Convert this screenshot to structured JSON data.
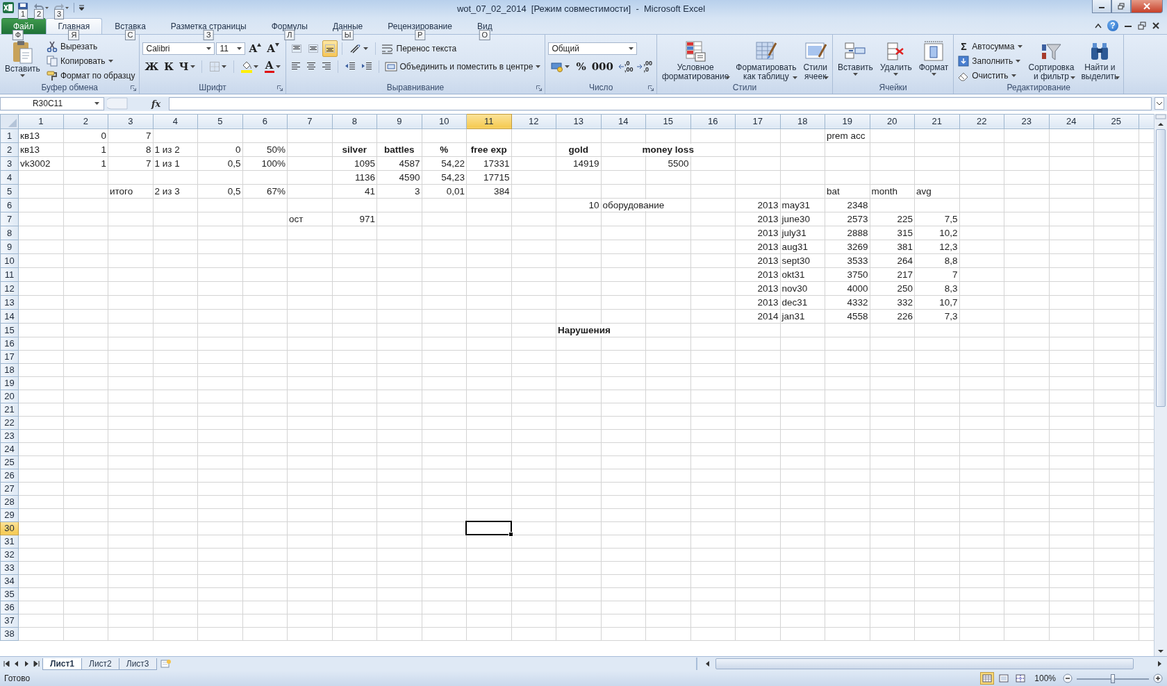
{
  "window": {
    "title": "wot_07_02_2014  [Режим совместимости]  -  Microsoft Excel",
    "help": "?"
  },
  "quick_access": {
    "keytips": [
      "1",
      "2",
      "3"
    ]
  },
  "ribbon_tabs": [
    {
      "label": "Файл",
      "keytip": "Ф",
      "kind": "file",
      "selected": false
    },
    {
      "label": "Главная",
      "keytip": "Я",
      "kind": "tab",
      "selected": true
    },
    {
      "label": "Вставка",
      "keytip": "С",
      "kind": "tab",
      "selected": false
    },
    {
      "label": "Разметка страницы",
      "keytip": "З",
      "kind": "tab",
      "selected": false
    },
    {
      "label": "Формулы",
      "keytip": "Л",
      "kind": "tab",
      "selected": false
    },
    {
      "label": "Данные",
      "keytip": "Ы",
      "kind": "tab",
      "selected": false
    },
    {
      "label": "Рецензирование",
      "keytip": "Р",
      "kind": "tab",
      "selected": false
    },
    {
      "label": "Вид",
      "keytip": "О",
      "kind": "tab",
      "selected": false
    }
  ],
  "ribbon_groups": [
    {
      "label": "Буфер обмена",
      "launcher": true,
      "controls": [
        {
          "kind": "large",
          "label_lines": [
            "Вставить"
          ],
          "dropdown": true
        },
        {
          "kind": "stack",
          "items": [
            {
              "kind": "text",
              "label": "Вырезать"
            },
            {
              "kind": "text",
              "label": "Копировать",
              "dropdown": true
            },
            {
              "kind": "text",
              "label": "Формат по образцу"
            }
          ]
        }
      ]
    },
    {
      "label": "Шрифт",
      "launcher": true,
      "controls": [
        {
          "kind": "rows",
          "rows": [
            [
              {
                "kind": "combo",
                "value": "Calibri"
              },
              {
                "kind": "combo",
                "value": "11"
              },
              {
                "kind": "glyph",
                "text": "A"
              },
              {
                "kind": "glyph",
                "text": "A"
              }
            ],
            [
              {
                "kind": "glyph",
                "text": "Ж"
              },
              {
                "kind": "glyph",
                "text": "К"
              },
              {
                "kind": "glyph",
                "text": "Ч",
                "dropdown": true
              },
              {
                "kind": "sep"
              },
              {
                "kind": "icon",
                "dropdown": true
              },
              {
                "kind": "sep"
              },
              {
                "kind": "icon",
                "dropdown": true
              },
              {
                "kind": "glyph",
                "text": "A",
                "dropdown": true
              }
            ]
          ]
        }
      ]
    },
    {
      "label": "Выравнивание",
      "launcher": true,
      "controls": [
        {
          "kind": "rows",
          "rows": [
            [
              {
                "kind": "icon",
                "on": false
              },
              {
                "kind": "icon",
                "on": false
              },
              {
                "kind": "icon",
                "on": true
              },
              {
                "kind": "sep"
              },
              {
                "kind": "icon",
                "dropdown": true
              },
              {
                "kind": "sep"
              },
              {
                "kind": "text",
                "label": "Перенос текста"
              }
            ],
            [
              {
                "kind": "icon",
                "on": false
              },
              {
                "kind": "icon",
                "on": false
              },
              {
                "kind": "icon",
                "on": false
              },
              {
                "kind": "sep"
              },
              {
                "kind": "icon"
              },
              {
                "kind": "icon"
              },
              {
                "kind": "sep"
              },
              {
                "kind": "text",
                "label": "Объединить и поместить в центре",
                "dropdown": true
              }
            ]
          ]
        }
      ]
    },
    {
      "label": "Число",
      "launcher": true,
      "controls": [
        {
          "kind": "rows",
          "rows": [
            [
              {
                "kind": "combo",
                "value": "Общий"
              }
            ],
            [
              {
                "kind": "icon",
                "dropdown": true
              },
              {
                "kind": "glyph",
                "text": "%"
              },
              {
                "kind": "glyph",
                "text": "000"
              },
              {
                "kind": "decimal",
                "lines": [
                  ",0",
                  ",00"
                ]
              },
              {
                "kind": "decimal",
                "lines": [
                  ",00",
                  ",0"
                ]
              }
            ]
          ]
        }
      ]
    },
    {
      "label": "Стили",
      "controls": [
        {
          "kind": "large",
          "label_lines": [
            "Условное",
            "форматирование"
          ],
          "dropdown": true
        },
        {
          "kind": "large",
          "label_lines": [
            "Форматировать",
            "как таблицу"
          ],
          "dropdown": true
        },
        {
          "kind": "large",
          "label_lines": [
            "Стили",
            "ячеек"
          ],
          "dropdown": true
        }
      ]
    },
    {
      "label": "Ячейки",
      "controls": [
        {
          "kind": "large",
          "label_lines": [
            "Вставить"
          ],
          "dropdown": true
        },
        {
          "kind": "large",
          "label_lines": [
            "Удалить"
          ],
          "dropdown": true
        },
        {
          "kind": "large",
          "label_lines": [
            "Формат"
          ],
          "dropdown": true
        }
      ]
    },
    {
      "label": "Редактирование",
      "controls": [
        {
          "kind": "stack",
          "items": [
            {
              "kind": "text",
              "glyph": "Σ",
              "label": "Автосумма",
              "dropdown": true
            },
            {
              "kind": "text",
              "label": "Заполнить",
              "dropdown": true
            },
            {
              "kind": "text",
              "label": "Очистить",
              "dropdown": true
            }
          ]
        },
        {
          "kind": "large",
          "label_lines": [
            "Сортировка",
            "и фильтр"
          ],
          "dropdown": true
        },
        {
          "kind": "large",
          "label_lines": [
            "Найти и",
            "выделить"
          ],
          "dropdown": true
        }
      ]
    }
  ],
  "formula_bar": {
    "name_box": "R30C11",
    "fx": "fx"
  },
  "columns": [
    {
      "label": "1",
      "selected": false
    },
    {
      "label": "2",
      "selected": false
    },
    {
      "label": "3",
      "selected": false
    },
    {
      "label": "4",
      "selected": false
    },
    {
      "label": "5",
      "selected": false
    },
    {
      "label": "6",
      "selected": false
    },
    {
      "label": "7",
      "selected": false
    },
    {
      "label": "8",
      "selected": false
    },
    {
      "label": "9",
      "selected": false
    },
    {
      "label": "10",
      "selected": false
    },
    {
      "label": "11",
      "selected": true
    },
    {
      "label": "12",
      "selected": false
    },
    {
      "label": "13",
      "selected": false
    },
    {
      "label": "14",
      "selected": false
    },
    {
      "label": "15",
      "selected": false
    },
    {
      "label": "16",
      "selected": false
    },
    {
      "label": "17",
      "selected": false
    },
    {
      "label": "18",
      "selected": false
    },
    {
      "label": "19",
      "selected": false
    },
    {
      "label": "20",
      "selected": false
    },
    {
      "label": "21",
      "selected": false
    },
    {
      "label": "22",
      "selected": false
    },
    {
      "label": "23",
      "selected": false
    },
    {
      "label": "24",
      "selected": false
    },
    {
      "label": "25",
      "selected": false
    }
  ],
  "rows": [
    {
      "label": "1",
      "selected": false,
      "cells": [
        {
          "text": "кв13",
          "kind": "text"
        },
        {
          "text": "0",
          "kind": "number"
        },
        {
          "text": "7",
          "kind": "number"
        },
        null,
        null,
        null,
        null,
        null,
        null,
        null,
        null,
        null,
        null,
        null,
        null,
        null,
        null,
        null,
        {
          "text": "prem acc",
          "kind": "text"
        }
      ]
    },
    {
      "label": "2",
      "selected": false,
      "cells": [
        {
          "text": "кв13",
          "kind": "text"
        },
        {
          "text": "1",
          "kind": "number"
        },
        {
          "text": "8",
          "kind": "number"
        },
        {
          "text": "1 из 2",
          "kind": "text"
        },
        {
          "text": "0",
          "kind": "number"
        },
        {
          "text": "50%",
          "kind": "number"
        },
        null,
        {
          "text": "silver",
          "kind": "heading"
        },
        {
          "text": "battles",
          "kind": "heading"
        },
        {
          "text": "%",
          "kind": "heading"
        },
        {
          "text": "free exp",
          "kind": "heading"
        },
        null,
        {
          "text": "gold",
          "kind": "heading"
        },
        null,
        {
          "text": "money loss",
          "kind": "heading"
        }
      ]
    },
    {
      "label": "3",
      "selected": false,
      "cells": [
        {
          "text": "vk3002",
          "kind": "text"
        },
        {
          "text": "1",
          "kind": "number"
        },
        {
          "text": "7",
          "kind": "number"
        },
        {
          "text": "1 из 1",
          "kind": "text"
        },
        {
          "text": "0,5",
          "kind": "number"
        },
        {
          "text": "100%",
          "kind": "number"
        },
        null,
        {
          "text": "1095",
          "kind": "number"
        },
        {
          "text": "4587",
          "kind": "number"
        },
        {
          "text": "54,22",
          "kind": "number"
        },
        {
          "text": "17331",
          "kind": "number"
        },
        null,
        {
          "text": "14919",
          "kind": "number"
        },
        null,
        {
          "text": "5500",
          "kind": "number"
        }
      ]
    },
    {
      "label": "4",
      "selected": false,
      "cells": [
        null,
        null,
        null,
        null,
        null,
        null,
        null,
        {
          "text": "1136",
          "kind": "number"
        },
        {
          "text": "4590",
          "kind": "number"
        },
        {
          "text": "54,23",
          "kind": "number"
        },
        {
          "text": "17715",
          "kind": "number"
        }
      ]
    },
    {
      "label": "5",
      "selected": false,
      "cells": [
        null,
        null,
        {
          "text": "итого",
          "kind": "text"
        },
        {
          "text": "2 из 3",
          "kind": "text"
        },
        {
          "text": "0,5",
          "kind": "number"
        },
        {
          "text": "67%",
          "kind": "number"
        },
        null,
        {
          "text": "41",
          "kind": "number"
        },
        {
          "text": "3",
          "kind": "number"
        },
        {
          "text": "0,01",
          "kind": "number"
        },
        {
          "text": "384",
          "kind": "number"
        },
        null,
        null,
        null,
        null,
        null,
        null,
        null,
        {
          "text": "bat",
          "kind": "text"
        },
        {
          "text": "month",
          "kind": "text"
        },
        {
          "text": "avg",
          "kind": "text"
        }
      ]
    },
    {
      "label": "6",
      "selected": false,
      "cells": [
        null,
        null,
        null,
        null,
        null,
        null,
        null,
        null,
        null,
        null,
        null,
        null,
        {
          "text": "10",
          "kind": "number"
        },
        {
          "text": "оборудование",
          "kind": "text"
        },
        null,
        null,
        {
          "text": "2013",
          "kind": "number"
        },
        {
          "text": "may31",
          "kind": "text"
        },
        {
          "text": "2348",
          "kind": "number"
        }
      ]
    },
    {
      "label": "7",
      "selected": false,
      "cells": [
        null,
        null,
        null,
        null,
        null,
        null,
        {
          "text": "ост",
          "kind": "text"
        },
        {
          "text": "971",
          "kind": "number"
        },
        null,
        null,
        null,
        null,
        null,
        null,
        null,
        null,
        {
          "text": "2013",
          "kind": "number"
        },
        {
          "text": "june30",
          "kind": "text"
        },
        {
          "text": "2573",
          "kind": "number"
        },
        {
          "text": "225",
          "kind": "number"
        },
        {
          "text": "7,5",
          "kind": "number"
        }
      ]
    },
    {
      "label": "8",
      "selected": false,
      "cells": [
        null,
        null,
        null,
        null,
        null,
        null,
        null,
        null,
        null,
        null,
        null,
        null,
        null,
        null,
        null,
        null,
        {
          "text": "2013",
          "kind": "number"
        },
        {
          "text": "july31",
          "kind": "text"
        },
        {
          "text": "2888",
          "kind": "number"
        },
        {
          "text": "315",
          "kind": "number"
        },
        {
          "text": "10,2",
          "kind": "number"
        }
      ]
    },
    {
      "label": "9",
      "selected": false,
      "cells": [
        null,
        null,
        null,
        null,
        null,
        null,
        null,
        null,
        null,
        null,
        null,
        null,
        null,
        null,
        null,
        null,
        {
          "text": "2013",
          "kind": "number"
        },
        {
          "text": "aug31",
          "kind": "text"
        },
        {
          "text": "3269",
          "kind": "number"
        },
        {
          "text": "381",
          "kind": "number"
        },
        {
          "text": "12,3",
          "kind": "number"
        }
      ]
    },
    {
      "label": "10",
      "selected": false,
      "cells": [
        null,
        null,
        null,
        null,
        null,
        null,
        null,
        null,
        null,
        null,
        null,
        null,
        null,
        null,
        null,
        null,
        {
          "text": "2013",
          "kind": "number"
        },
        {
          "text": "sept30",
          "kind": "text"
        },
        {
          "text": "3533",
          "kind": "number"
        },
        {
          "text": "264",
          "kind": "number"
        },
        {
          "text": "8,8",
          "kind": "number"
        }
      ]
    },
    {
      "label": "11",
      "selected": false,
      "cells": [
        null,
        null,
        null,
        null,
        null,
        null,
        null,
        null,
        null,
        null,
        null,
        null,
        null,
        null,
        null,
        null,
        {
          "text": "2013",
          "kind": "number"
        },
        {
          "text": "okt31",
          "kind": "text"
        },
        {
          "text": "3750",
          "kind": "number"
        },
        {
          "text": "217",
          "kind": "number"
        },
        {
          "text": "7",
          "kind": "number"
        }
      ]
    },
    {
      "label": "12",
      "selected": false,
      "cells": [
        null,
        null,
        null,
        null,
        null,
        null,
        null,
        null,
        null,
        null,
        null,
        null,
        null,
        null,
        null,
        null,
        {
          "text": "2013",
          "kind": "number"
        },
        {
          "text": "nov30",
          "kind": "text"
        },
        {
          "text": "4000",
          "kind": "number"
        },
        {
          "text": "250",
          "kind": "number"
        },
        {
          "text": "8,3",
          "kind": "number"
        }
      ]
    },
    {
      "label": "13",
      "selected": false,
      "cells": [
        null,
        null,
        null,
        null,
        null,
        null,
        null,
        null,
        null,
        null,
        null,
        null,
        null,
        null,
        null,
        null,
        {
          "text": "2013",
          "kind": "number"
        },
        {
          "text": "dec31",
          "kind": "text"
        },
        {
          "text": "4332",
          "kind": "number"
        },
        {
          "text": "332",
          "kind": "number"
        },
        {
          "text": "10,7",
          "kind": "number"
        }
      ]
    },
    {
      "label": "14",
      "selected": false,
      "cells": [
        null,
        null,
        null,
        null,
        null,
        null,
        null,
        null,
        null,
        null,
        null,
        null,
        null,
        null,
        null,
        null,
        {
          "text": "2014",
          "kind": "number"
        },
        {
          "text": "jan31",
          "kind": "text"
        },
        {
          "text": "4558",
          "kind": "number"
        },
        {
          "text": "226",
          "kind": "number"
        },
        {
          "text": "7,3",
          "kind": "number"
        }
      ]
    },
    {
      "label": "15",
      "selected": false,
      "cells": [
        null,
        null,
        null,
        null,
        null,
        null,
        null,
        null,
        null,
        null,
        null,
        null,
        {
          "text": "Нарушения",
          "kind": "text",
          "bold": true
        }
      ]
    },
    {
      "label": "16",
      "selected": false
    },
    {
      "label": "17",
      "selected": false
    },
    {
      "label": "18",
      "selected": false
    },
    {
      "label": "19",
      "selected": false
    },
    {
      "label": "20",
      "selected": false
    },
    {
      "label": "21",
      "selected": false
    },
    {
      "label": "22",
      "selected": false
    },
    {
      "label": "23",
      "selected": false
    },
    {
      "label": "24",
      "selected": false
    },
    {
      "label": "25",
      "selected": false
    },
    {
      "label": "26",
      "selected": false
    },
    {
      "label": "27",
      "selected": false
    },
    {
      "label": "28",
      "selected": false
    },
    {
      "label": "29",
      "selected": false
    },
    {
      "label": "30",
      "selected": true
    },
    {
      "label": "31",
      "selected": false
    },
    {
      "label": "32",
      "selected": false
    },
    {
      "label": "33",
      "selected": false
    },
    {
      "label": "34",
      "selected": false
    },
    {
      "label": "35",
      "selected": false
    },
    {
      "label": "36",
      "selected": false
    },
    {
      "label": "37",
      "selected": false
    },
    {
      "label": "38",
      "selected": false
    }
  ],
  "sheet_tabs": [
    {
      "label": "Лист1",
      "selected": true
    },
    {
      "label": "Лист2",
      "selected": false
    },
    {
      "label": "Лист3",
      "selected": false
    }
  ],
  "status_bar": {
    "text": "Готово",
    "views": [
      {
        "kind": "normal",
        "selected": true
      },
      {
        "kind": "layout",
        "selected": false
      },
      {
        "kind": "break",
        "selected": false
      }
    ],
    "zoom": {
      "label": "100%",
      "level": 0.5
    }
  }
}
